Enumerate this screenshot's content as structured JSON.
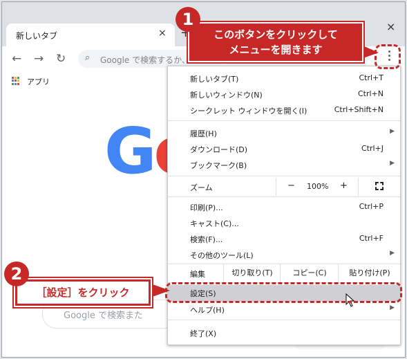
{
  "browser": {
    "tab_title": "新しいタブ",
    "tab_close": "×",
    "new_tab": "+",
    "window_close": "×",
    "omnibox_placeholder": "Google で検索するか、URL を入力",
    "bookmarks_apps": "アプリ",
    "page_search_placeholder": "Google で検索また"
  },
  "menu": {
    "new_tab": {
      "label": "新しいタブ(T)",
      "shortcut": "Ctrl+T"
    },
    "new_window": {
      "label": "新しいウィンドウ(N)",
      "shortcut": "Ctrl+N"
    },
    "incognito": {
      "label": "シークレット ウィンドウを開く(I)",
      "shortcut": "Ctrl+Shift+N"
    },
    "history": {
      "label": "履歴(H)"
    },
    "downloads": {
      "label": "ダウンロード(D)",
      "shortcut": "Ctrl+J"
    },
    "bookmarks": {
      "label": "ブックマーク(B)"
    },
    "zoom": {
      "label": "ズーム",
      "minus": "−",
      "value": "100%",
      "plus": "+"
    },
    "print": {
      "label": "印刷(P)...",
      "shortcut": "Ctrl+P"
    },
    "cast": {
      "label": "キャスト(C)..."
    },
    "find": {
      "label": "検索(F)...",
      "shortcut": "Ctrl+F"
    },
    "more_tools": {
      "label": "その他のツール(L)"
    },
    "edit": {
      "label": "編集",
      "cut": "切り取り(T)",
      "copy": "コピー(C)",
      "paste": "貼り付け(P)"
    },
    "settings": {
      "label": "設定(S)"
    },
    "help": {
      "label": "ヘルプ(H)"
    },
    "exit": {
      "label": "終了(X)"
    }
  },
  "annotations": {
    "step1_number": "1",
    "step1_text_line1": "このボタンをクリックして",
    "step1_text_line2": "メニューを開きます",
    "step2_number": "2",
    "step2_text": "［設定］をクリック"
  },
  "colors": {
    "accent": "#c62828",
    "menu_highlight": "#cfcfd4"
  }
}
